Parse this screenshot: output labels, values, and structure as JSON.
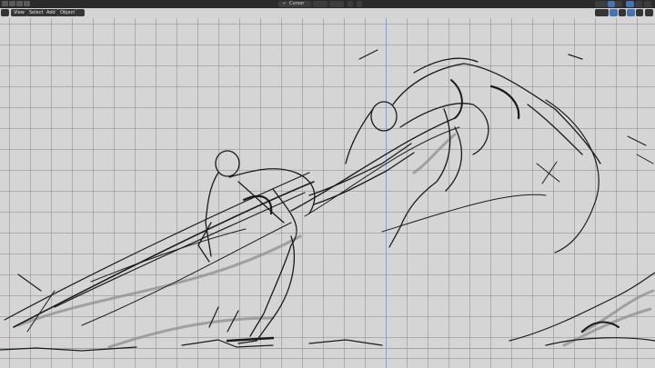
{
  "topbar": {
    "transform_pivot_label": "Cursor"
  },
  "header": {
    "menu": {
      "view": "View",
      "select": "Select",
      "add": "Add",
      "object": "Object"
    }
  },
  "colors": {
    "header_bg": "#2b2b2b",
    "button_bg": "#353535",
    "accent": "#4772b3",
    "viewport_bg": "#d5d5d5",
    "x_axis": "#d98c8c",
    "z_axis": "#8a9cc8"
  }
}
